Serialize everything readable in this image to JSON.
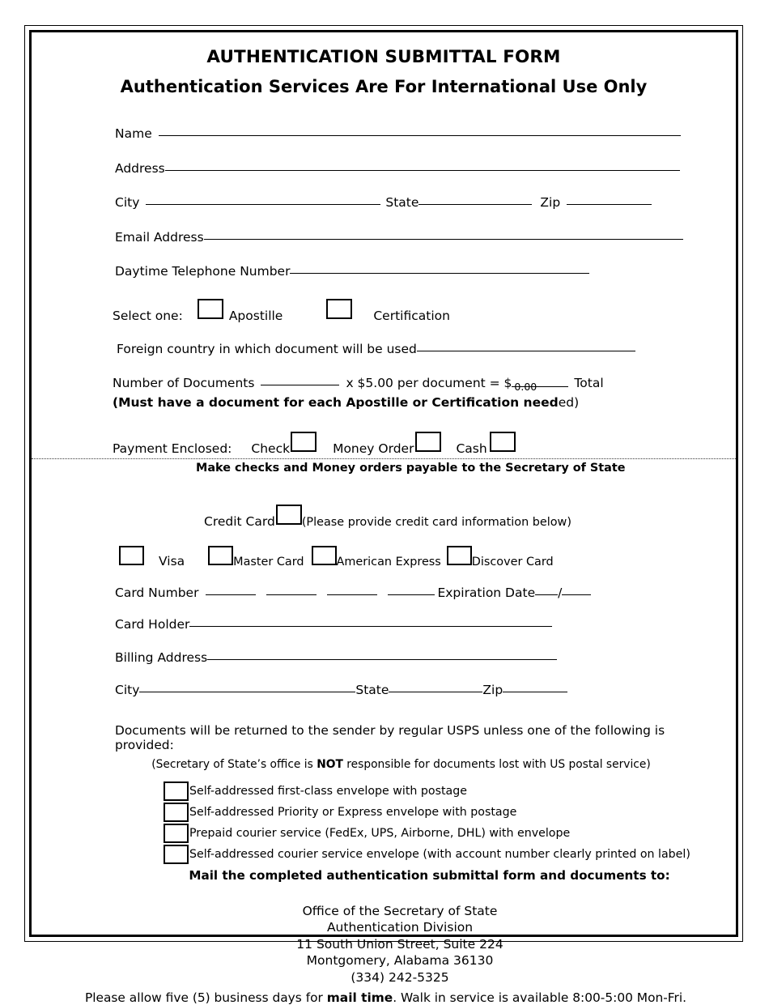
{
  "document": {
    "title_main": "AUTHENTICATION SUBMITTAL FORM",
    "title_sub": "Authentication Services Are For International Use Only"
  },
  "applicant": {
    "name_label": "Name",
    "address_label": "Address",
    "city_label": "City",
    "state_label": "State",
    "zip_label": "Zip",
    "email_label": "Email Address",
    "phone_label": "Daytime Telephone Number",
    "name_value": "",
    "address_value": "",
    "city_value": "",
    "state_value": "",
    "zip_value": "",
    "email_value": "",
    "phone_value": ""
  },
  "select_one": {
    "label": "Select one:",
    "options": [
      {
        "label": "Apostille",
        "checked": false
      },
      {
        "label": "Certification",
        "checked": false
      }
    ]
  },
  "foreign_country": {
    "label": "Foreign country in which document will be used",
    "value": ""
  },
  "documents": {
    "count_label": "Number of Documents",
    "count_value": "",
    "rate_label": "x $5.00 per document = $",
    "total_value": "0.00",
    "total_label": "Total",
    "note_bold": "(Must have a document for each Apostille or Certification need",
    "note_tail": "ed)"
  },
  "payment": {
    "label": "Payment Enclosed:",
    "methods": [
      {
        "label": "Check",
        "checked": false
      },
      {
        "label": "Money Order",
        "checked": false
      },
      {
        "label": "Cash",
        "checked": false
      }
    ],
    "note": "Make checks and Money orders payable to the Secretary of State"
  },
  "credit_card": {
    "label": "Credit Card",
    "hint": "(Please provide credit card information below)",
    "types": [
      {
        "label": "Visa",
        "checked": false
      },
      {
        "label": "Master Card",
        "checked": false
      },
      {
        "label": "American Express",
        "checked": false
      },
      {
        "label": "Discover Card",
        "checked": false
      }
    ],
    "card_number_label": "Card Number",
    "card_number_value": "",
    "expiration_label": "Expiration Date",
    "expiration_month": "",
    "expiration_year": "",
    "card_holder_label": "Card Holder",
    "card_holder_value": "",
    "billing_address_label": "Billing Address",
    "billing_address_value": "",
    "billing_city_label": "City",
    "billing_city_value": "",
    "billing_state_label": "State",
    "billing_state_value": "",
    "billing_zip_label": "Zip",
    "billing_zip_value": ""
  },
  "return_options": {
    "intro": "Documents will be returned to the sender by regular USPS unless one of the following is provided:",
    "disclaimer_pre": "(Secretary of State’s office is ",
    "disclaimer_bold": "NOT",
    "disclaimer_post": " responsible for documents lost with US postal service)",
    "items": [
      {
        "label": "Self-addressed first-class envelope with postage",
        "checked": false
      },
      {
        "label": "Self-addressed Priority or Express envelope with postage",
        "checked": false
      },
      {
        "label": "Prepaid courier service (FedEx, UPS, Airborne, DHL) with envelope",
        "checked": false
      },
      {
        "label": "Self-addressed courier service envelope (with account number clearly printed on label)",
        "checked": false
      }
    ],
    "mail_to_heading": "Mail the completed authentication submittal form and documents to:"
  },
  "office": {
    "line1": "Office of the Secretary of State",
    "line2": "Authentication Division",
    "line3": "11 South Union Street, Suite 224",
    "line4": "Montgomery, Alabama 36130",
    "line5": "(334) 242-5325"
  },
  "footer": {
    "pre": "Please allow five (5) business days for ",
    "bold": "mail time",
    "post": ". Walk in service is available 8:00-5:00 Mon-Fri."
  }
}
